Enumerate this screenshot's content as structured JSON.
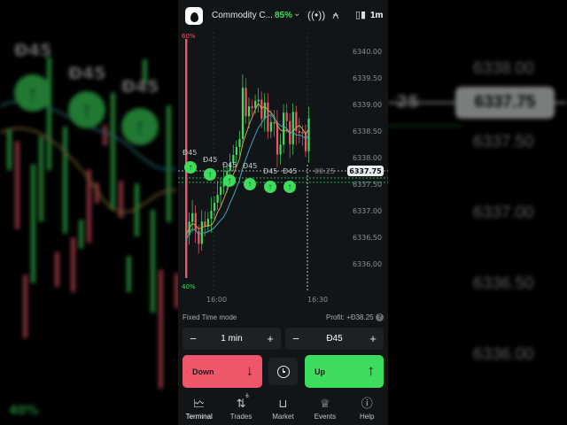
{
  "backdrop": {
    "trade_amounts": [
      "Đ45",
      "Đ45",
      "Đ45",
      "25"
    ],
    "price_levels": [
      "6338.00",
      "6337.50",
      "6337.00",
      "6336.50",
      "6336.00"
    ],
    "current_price": "6337.75",
    "bottom_pct": "40%"
  },
  "header": {
    "asset_name": "Commodity C...",
    "payout": "85%",
    "timeframe": "1m"
  },
  "chart": {
    "y_labels": [
      "6340.00",
      "6339.50",
      "6339.00",
      "6338.50",
      "6338.00",
      "6337.50",
      "6337.00",
      "6336.50",
      "6336.00"
    ],
    "x_labels": [
      "16:00",
      "16:30"
    ],
    "sentiment_top": "60%",
    "sentiment_bottom": "40%",
    "trade_amounts": [
      "Đ45",
      "Đ45",
      "Đ45",
      "Đ45",
      "Đ45",
      "Đ45"
    ],
    "countdown": "00:25",
    "current_price": "6337.75",
    "colors": {
      "up": "#3ddc5c",
      "down": "#f0566a",
      "ma_fast": "#c9a24a",
      "ma_slow": "#3fa7b8"
    }
  },
  "controls": {
    "mode": "Fixed Time mode",
    "profit_label": "Profit:",
    "profit_value": "+Đ38.25",
    "time_value": "1 min",
    "amount_value": "Đ45",
    "minus": "−",
    "plus": "+",
    "down_label": "Down",
    "up_label": "Up",
    "help": "?"
  },
  "nav": {
    "items": [
      {
        "label": "Terminal",
        "icon": "chart-icon"
      },
      {
        "label": "Trades",
        "icon": "trades-icon",
        "badge": "6"
      },
      {
        "label": "Market",
        "icon": "bag-icon"
      },
      {
        "label": "Events",
        "icon": "trophy-icon"
      },
      {
        "label": "Help",
        "icon": "help-icon"
      }
    ]
  }
}
